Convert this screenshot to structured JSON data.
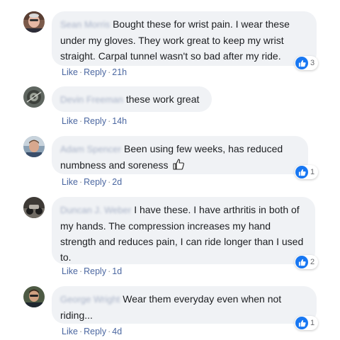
{
  "comments": [
    {
      "author": "Sean Morris",
      "text": "Bought these for wrist pain. I wear these under my gloves. They work great to keep my wrist straight. Carpal tunnel wasn't so bad after my ride.",
      "reactions": "3",
      "like_label": "Like",
      "reply_label": "Reply",
      "time": "21h"
    },
    {
      "author": "Devin Freeman",
      "text": "these work great",
      "like_label": "Like",
      "reply_label": "Reply",
      "time": "14h"
    },
    {
      "author": "Adam Spencer",
      "text": "Been using few weeks, has reduced numbness and soreness",
      "reactions": "1",
      "like_label": "Like",
      "reply_label": "Reply",
      "time": "2d"
    },
    {
      "author": "Duncan J. Weber",
      "text": "I have these. I have arthritis in both of my hands. The compression increases my hand strength and reduces pain, I can ride longer than I used to.",
      "reactions": "2",
      "like_label": "Like",
      "reply_label": "Reply",
      "time": "1d"
    },
    {
      "author": "George Wright",
      "text": "Wear them everyday even when not riding...",
      "reactions": "1",
      "like_label": "Like",
      "reply_label": "Reply",
      "time": "4d"
    }
  ],
  "separator": "·",
  "colors": {
    "bubble": "#f0f2f5",
    "link": "#4b67a1",
    "like_blue": "#1877f2"
  }
}
